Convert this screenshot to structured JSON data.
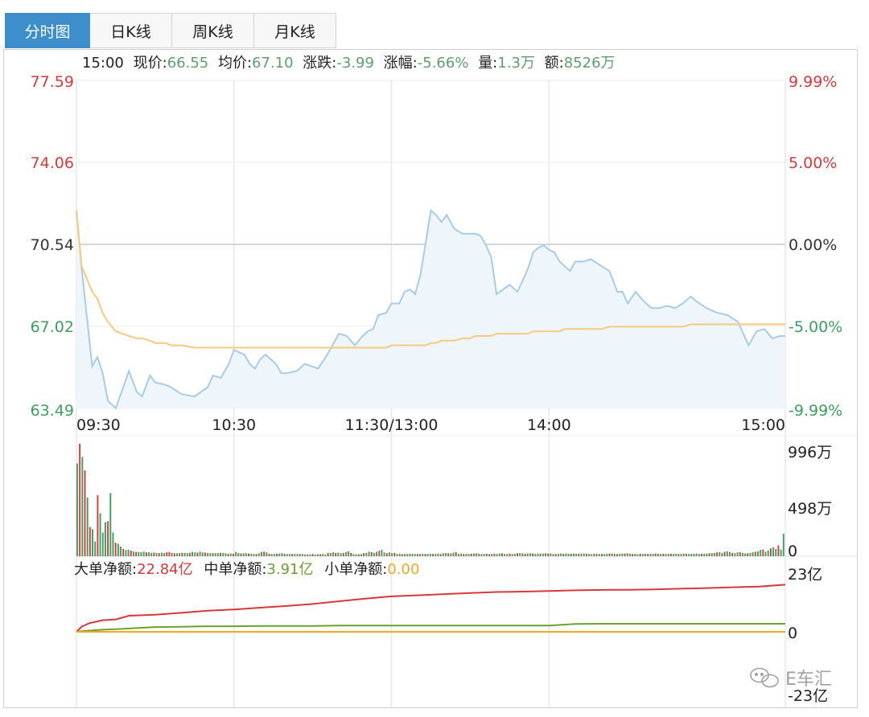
{
  "tabs": [
    {
      "label": "分时图",
      "active": true
    },
    {
      "label": "日K线",
      "active": false
    },
    {
      "label": "周K线",
      "active": false
    },
    {
      "label": "月K线",
      "active": false
    }
  ],
  "info_bar": {
    "time": "15:00",
    "price_label": "现价:",
    "price": "66.55",
    "avg_label": "均价:",
    "avg": "67.10",
    "change_label": "涨跌:",
    "change": "-3.99",
    "pct_label": "涨幅:",
    "pct": "-5.66%",
    "vol_label": "量:",
    "vol": "1.3万",
    "amount_label": "额:",
    "amount": "8526万"
  },
  "flow_bar": {
    "large_label": "大单净额:",
    "large": "22.84亿",
    "medium_label": "中单净额:",
    "medium": "3.91亿",
    "small_label": "小单净额:",
    "small": "0.00"
  },
  "watermark": "E车汇",
  "colors": {
    "price_line": "#a9cbe8",
    "price_fill": "#eef6fc",
    "avg_line": "#f7c97e",
    "up": "#d9383a",
    "down": "#3c9e5f",
    "neutral": "#333333",
    "large_flow": "#d9383a",
    "medium_flow": "#6aa22b",
    "small_flow": "#f5a623"
  },
  "chart_data": [
    {
      "type": "line",
      "x_ticks": [
        "09:30",
        "10:30",
        "11:30/13:00",
        "14:00",
        "15:00"
      ],
      "left_ticks": [
        "77.59",
        "74.06",
        "70.54",
        "67.02",
        "63.49"
      ],
      "right_ticks": [
        "9.99%",
        "5.00%",
        "0.00%",
        "-5.00%",
        "-9.99%"
      ],
      "ylim": [
        63.49,
        77.59
      ],
      "prev_close": 70.54,
      "x": [
        0,
        2,
        6,
        8,
        10,
        12,
        15,
        20,
        23,
        25,
        28,
        30,
        34,
        36,
        40,
        45,
        50,
        52,
        55,
        58,
        60,
        64,
        66,
        68,
        70,
        72,
        74,
        76,
        78,
        80,
        84,
        87,
        92,
        95,
        100,
        103,
        106,
        109,
        111,
        113,
        115,
        118,
        120,
        123,
        125,
        127,
        129,
        131,
        133,
        135,
        137,
        139,
        141,
        144,
        147,
        150,
        152,
        154,
        156,
        158,
        160,
        165,
        168,
        170,
        172,
        174,
        176,
        178,
        180,
        182,
        184,
        186,
        188,
        190,
        193,
        196,
        200,
        203,
        206,
        208,
        210,
        213,
        216,
        219,
        222,
        225,
        228,
        231,
        234,
        236,
        240,
        244,
        248,
        252,
        256,
        259,
        262,
        265,
        268,
        270
      ],
      "series": [
        {
          "name": "现价",
          "values": [
            72.0,
            69.5,
            65.3,
            65.7,
            65.0,
            63.8,
            63.5,
            65.1,
            64.2,
            64.0,
            64.9,
            64.6,
            64.5,
            64.4,
            64.1,
            64.0,
            64.4,
            64.9,
            64.8,
            65.4,
            66.0,
            65.8,
            65.4,
            65.2,
            65.6,
            65.8,
            65.6,
            65.4,
            65.0,
            65.0,
            65.1,
            65.4,
            65.2,
            65.7,
            66.7,
            66.6,
            66.2,
            66.6,
            66.8,
            66.9,
            67.5,
            67.6,
            68.0,
            68.0,
            68.5,
            68.6,
            68.4,
            69.2,
            70.6,
            72.0,
            71.8,
            71.5,
            71.8,
            71.2,
            71.0,
            71.0,
            71.0,
            70.9,
            70.5,
            70.0,
            68.4,
            68.8,
            68.5,
            69.0,
            69.5,
            70.2,
            70.4,
            70.5,
            70.3,
            70.2,
            69.8,
            69.6,
            69.4,
            69.8,
            69.8,
            69.9,
            69.6,
            69.4,
            68.5,
            68.5,
            68.0,
            68.5,
            68.1,
            67.8,
            67.8,
            67.9,
            67.8,
            68.0,
            68.3,
            68.1,
            67.8,
            67.6,
            67.5,
            67.2,
            66.2,
            66.8,
            66.9,
            66.5,
            66.6,
            66.6
          ]
        },
        {
          "name": "均价",
          "values": [
            72.0,
            69.6,
            68.5,
            68.2,
            67.6,
            67.2,
            66.8,
            66.6,
            66.5,
            66.5,
            66.4,
            66.3,
            66.3,
            66.2,
            66.2,
            66.1,
            66.1,
            66.1,
            66.1,
            66.1,
            66.1,
            66.1,
            66.1,
            66.1,
            66.1,
            66.1,
            66.1,
            66.1,
            66.1,
            66.1,
            66.1,
            66.1,
            66.1,
            66.1,
            66.1,
            66.1,
            66.1,
            66.1,
            66.1,
            66.1,
            66.1,
            66.1,
            66.2,
            66.2,
            66.2,
            66.2,
            66.2,
            66.2,
            66.2,
            66.3,
            66.3,
            66.4,
            66.4,
            66.4,
            66.5,
            66.5,
            66.6,
            66.6,
            66.6,
            66.6,
            66.7,
            66.7,
            66.7,
            66.7,
            66.7,
            66.8,
            66.8,
            66.8,
            66.8,
            66.8,
            66.8,
            66.9,
            66.9,
            66.9,
            66.9,
            66.9,
            66.9,
            67.0,
            67.0,
            67.0,
            67.0,
            67.0,
            67.0,
            67.0,
            67.0,
            67.0,
            67.0,
            67.0,
            67.1,
            67.1,
            67.1,
            67.1,
            67.1,
            67.1,
            67.1,
            67.1,
            67.1,
            67.1,
            67.1,
            67.1
          ]
        }
      ]
    },
    {
      "type": "bar",
      "right_ticks": [
        "996万",
        "498万",
        "0"
      ],
      "ylim": [
        0,
        996
      ],
      "y_unit": "万",
      "values": [
        820,
        996,
        880,
        760,
        520,
        260,
        240,
        130,
        540,
        380,
        210,
        300,
        310,
        560,
        210,
        120,
        110,
        85,
        65,
        55,
        58,
        50,
        42,
        38,
        38,
        36,
        40,
        35,
        35,
        30,
        32,
        30,
        28,
        32,
        28,
        35,
        38,
        30,
        26,
        26,
        28,
        30,
        30,
        28,
        30,
        38,
        34,
        32,
        40,
        34,
        32,
        30,
        28,
        28,
        28,
        28,
        30,
        30,
        26,
        22,
        24,
        22,
        38,
        30,
        24,
        28,
        26,
        24,
        22,
        20,
        20,
        26,
        38,
        40,
        34,
        22,
        20,
        20,
        22,
        24,
        28,
        22,
        20,
        20,
        20,
        20,
        20,
        20,
        20,
        16,
        16,
        18,
        20,
        16,
        18,
        18,
        20,
        16,
        30,
        30,
        34,
        30,
        32,
        26,
        30,
        36,
        44,
        30,
        20,
        18,
        18,
        20,
        28,
        30,
        40,
        36,
        30,
        40,
        48,
        56,
        34,
        28,
        34,
        26,
        30,
        20,
        22,
        18,
        20,
        20,
        20,
        22,
        20,
        20,
        22,
        22,
        20,
        20,
        22,
        20,
        20,
        24,
        20,
        26,
        28,
        26,
        26,
        32,
        36,
        20,
        24,
        20,
        22,
        20,
        22,
        24,
        26,
        22,
        20,
        20,
        22,
        20,
        20,
        22,
        20,
        24,
        26,
        20,
        20,
        24,
        20,
        22,
        26,
        28,
        26,
        22,
        24,
        26,
        24,
        22,
        24,
        22,
        24,
        26,
        24,
        24,
        20,
        20,
        22,
        24,
        22,
        24,
        22,
        22,
        24,
        22,
        22,
        24,
        24,
        22,
        20,
        18,
        22,
        24,
        20,
        20,
        18,
        22,
        24,
        24,
        22,
        20,
        22,
        24,
        24,
        26,
        22,
        20,
        22,
        18,
        22,
        20,
        22,
        20,
        22,
        22,
        24,
        22,
        20,
        22,
        20,
        22,
        22,
        20,
        22,
        20,
        20,
        24,
        22,
        20,
        22,
        20,
        24,
        20,
        22,
        22,
        24,
        26,
        28,
        30,
        34,
        36,
        30,
        40,
        44,
        36,
        30,
        28,
        34,
        36,
        30,
        24,
        26,
        30,
        36,
        40,
        44,
        56,
        60,
        40,
        52,
        70,
        80,
        64,
        96,
        60,
        200
      ],
      "directions": "dudududduddduddudduddududdduddududduududdudduddudduddudduddududduddudduddududdudduddudduddududduddudduddudduddududdudduddudduddudduddudduddudduddudduddudduddudduddudduddudduddudduddudduddudduddudduddudduddudduddudduddudduddudduddudduddudduddudduddudduddudduddudduddudduddudduddudu"
    },
    {
      "type": "line",
      "right_ticks": [
        "23亿",
        "0",
        "-23亿"
      ],
      "ylim": [
        -23,
        23
      ],
      "y_unit": "亿",
      "x": [
        0,
        2,
        5,
        10,
        15,
        20,
        30,
        40,
        50,
        60,
        70,
        80,
        90,
        100,
        110,
        120,
        130,
        140,
        150,
        160,
        170,
        180,
        190,
        200,
        210,
        220,
        230,
        240,
        250,
        260,
        270
      ],
      "series": [
        {
          "name": "大单净额",
          "values": [
            0,
            2.5,
            4.2,
            5.6,
            6.0,
            7.8,
            8.3,
            9.2,
            10.2,
            10.8,
            11.7,
            12.5,
            13.5,
            14.8,
            16.1,
            17.2,
            17.7,
            18.3,
            18.8,
            19.3,
            19.5,
            19.8,
            20.1,
            20.3,
            20.4,
            20.6,
            20.9,
            21.2,
            21.6,
            21.9,
            22.84
          ]
        },
        {
          "name": "中单净额",
          "values": [
            0,
            0.3,
            0.6,
            1.0,
            1.3,
            1.6,
            2.3,
            2.4,
            2.7,
            2.7,
            2.8,
            2.8,
            2.8,
            3.0,
            3.0,
            3.0,
            3.0,
            3.0,
            3.0,
            3.0,
            3.0,
            3.0,
            3.8,
            3.9,
            3.9,
            3.9,
            3.9,
            3.9,
            3.9,
            3.9,
            3.91
          ]
        },
        {
          "name": "小单净额",
          "values": [
            0,
            0,
            0,
            0,
            0,
            0,
            0,
            0,
            0,
            0,
            0,
            0,
            0,
            0,
            0,
            0,
            0,
            0,
            0,
            0,
            0,
            0,
            0,
            0,
            0,
            0,
            0,
            0,
            0,
            0,
            0.0
          ]
        }
      ]
    }
  ]
}
